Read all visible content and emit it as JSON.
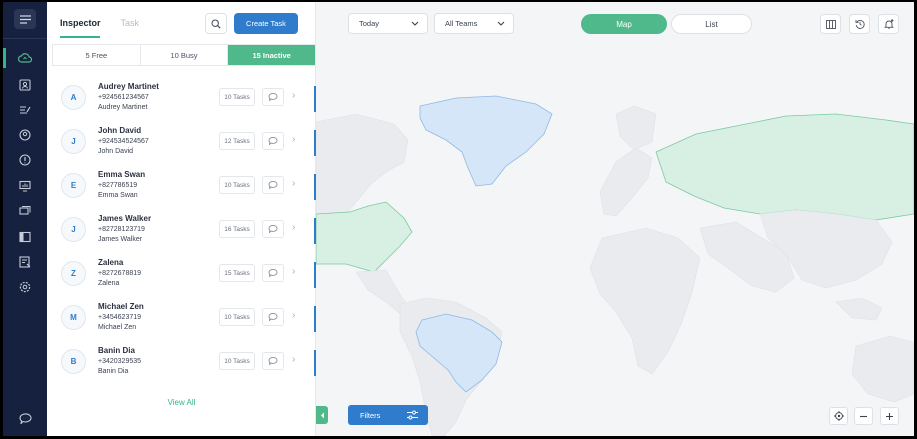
{
  "panel": {
    "tabs": [
      {
        "label": "Inspector",
        "active": true
      },
      {
        "label": "Task",
        "active": false
      }
    ],
    "create_label": "Create Task",
    "status": [
      {
        "label": "5 Free",
        "active": false
      },
      {
        "label": "10 Busy",
        "active": false
      },
      {
        "label": "15 Inactive",
        "active": true
      }
    ],
    "people": [
      {
        "initial": "A",
        "name": "Audrey Martinet",
        "phone": "+924561234567",
        "sub": "Audrey Martinet",
        "tasks": "10 Tasks"
      },
      {
        "initial": "J",
        "name": "John David",
        "phone": "+924534524567",
        "sub": "John David",
        "tasks": "12 Tasks"
      },
      {
        "initial": "E",
        "name": "Emma Swan",
        "phone": "+827786519",
        "sub": "Emma Swan",
        "tasks": "10 Tasks"
      },
      {
        "initial": "J",
        "name": "James Walker",
        "phone": "+82728123719",
        "sub": "James Walker",
        "tasks": "16 Tasks"
      },
      {
        "initial": "Z",
        "name": "Zalena",
        "phone": "+8272678819",
        "sub": "Zalena",
        "tasks": "15 Tasks"
      },
      {
        "initial": "M",
        "name": "Michael Zen",
        "phone": "+3454623719",
        "sub": "Michael Zen",
        "tasks": "10 Tasks"
      },
      {
        "initial": "B",
        "name": "Banin Dia",
        "phone": "+3420329535",
        "sub": "Banin Dia",
        "tasks": "10 Tasks"
      }
    ],
    "view_all": "View All"
  },
  "toolbar": {
    "date_filter": "Today",
    "team_filter": "All Teams",
    "map_label": "Map",
    "list_label": "List"
  },
  "map_controls": {
    "filters_label": "Filters"
  },
  "colors": {
    "rail": "#16213f",
    "accent_green": "#4fb98b",
    "accent_blue": "#2e7ccb",
    "land_gray": "#e9ebee",
    "land_green": "#d7f0e3",
    "land_blue": "#d4e6f8"
  },
  "icons": {
    "rail": [
      "menu-icon",
      "cloud-sync-icon",
      "contacts-icon",
      "edit-list-icon",
      "user-circle-icon",
      "alert-icon",
      "monitor-chart-icon",
      "cards-icon",
      "layout-icon",
      "report-icon",
      "settings-icon",
      "chat-icon"
    ]
  }
}
